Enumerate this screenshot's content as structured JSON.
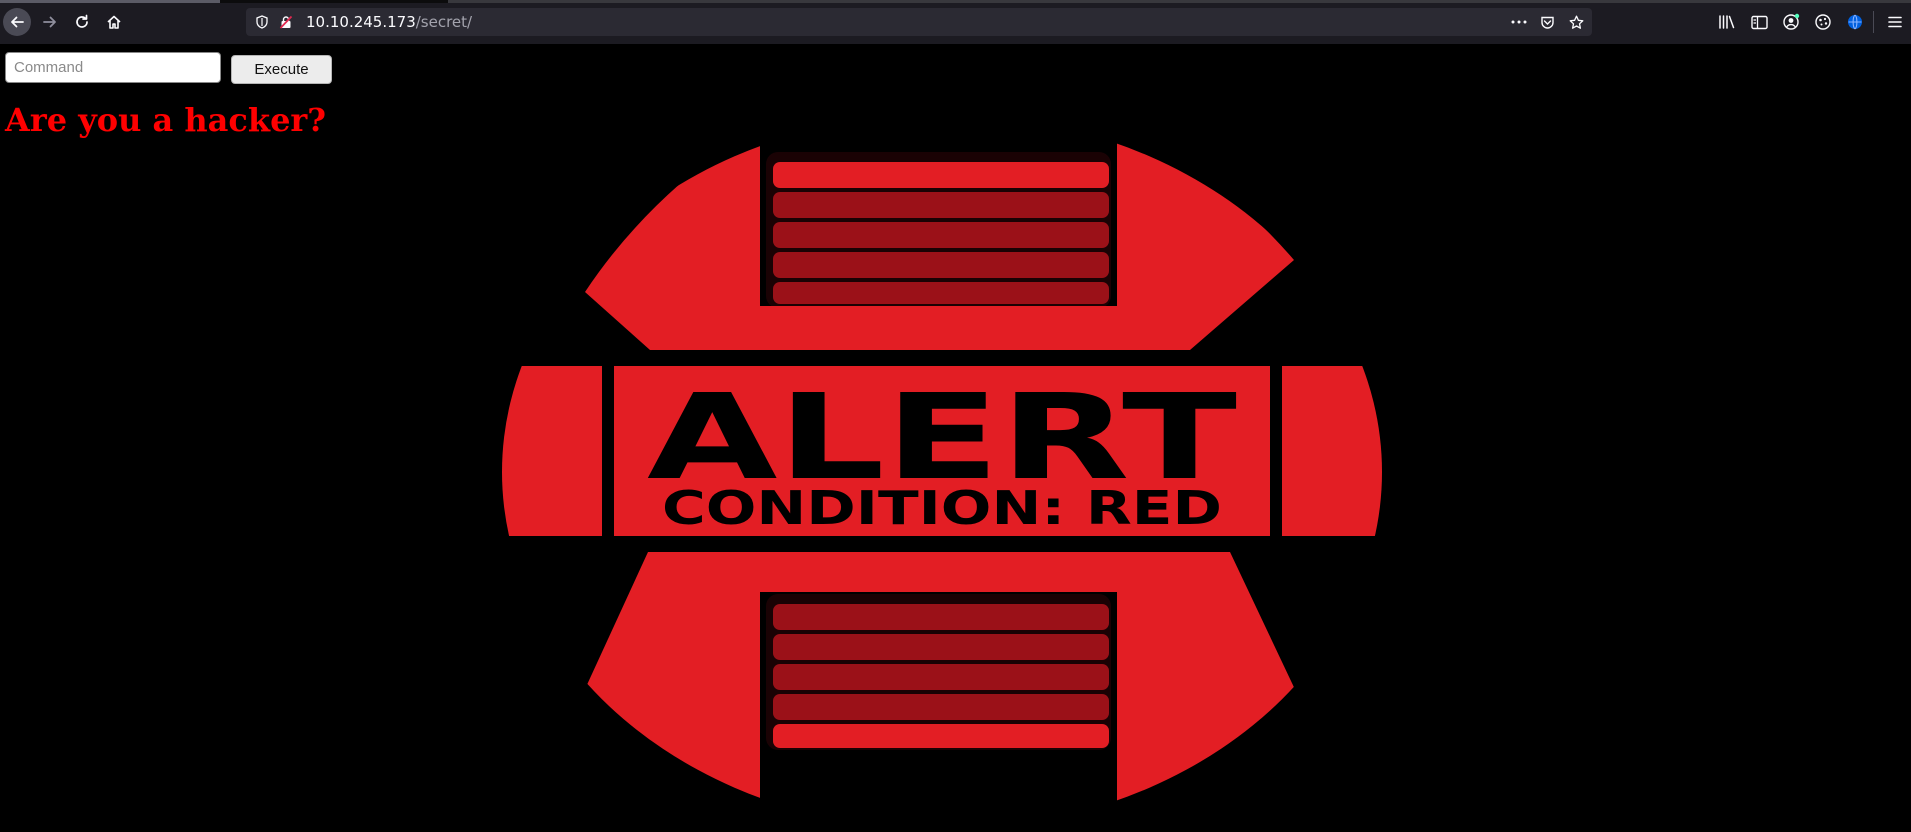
{
  "browser": {
    "url_host": "10.10.245.173",
    "url_path": "/secret/",
    "icons": [
      "back-icon",
      "forward-icon",
      "reload-icon",
      "home-icon",
      "shield-icon",
      "insecure-lock-icon",
      "more-icon",
      "pocket-icon",
      "bookmark-star-icon",
      "library-icon",
      "sidebar-icon",
      "account-icon",
      "extension-icon",
      "vpn-icon",
      "menu-icon"
    ]
  },
  "form": {
    "command_placeholder": "Command",
    "command_value": "",
    "execute_label": "Execute"
  },
  "heading": "Are you a hacker?",
  "alert_image": {
    "title": "ALERT",
    "subtitle": "CONDITION: RED",
    "color": "#e31e24",
    "dark_color": "#9b1118"
  }
}
